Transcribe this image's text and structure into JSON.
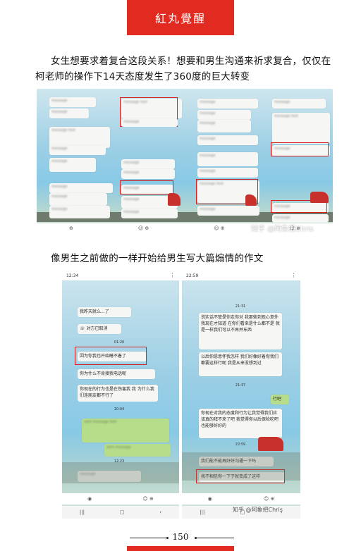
{
  "banner": {
    "title": "紅丸覺醒"
  },
  "paragraphs": {
    "p1": "女生想要求着复合这段关系！想要和男生沟通来祈求复合，仅仅在柯老师的操作下14天态度发生了360度的巨大转变",
    "p2": "像男生之前做的一样开始给男生写大篇煽情的作文"
  },
  "watermarks": {
    "top": "知乎 @阿象把Chris",
    "bottom": "知乎 @阿象把Chris"
  },
  "chat_left": {
    "status_time": "12:34",
    "messages": {
      "m1": "我昨天就么...了",
      "m2": "对方已取消",
      "t1": "01:20",
      "m3": "因为你我也开始睡不着了",
      "m4": "你为什么不肯接我电话呢",
      "m5": "你现在的行为也是在伤害我 我 为什么我们连朋友都不行了",
      "t2": "10:04",
      "t3": "12:23"
    }
  },
  "chat_right": {
    "status_time": "22:59",
    "messages": {
      "t1": "21:31",
      "m1": "说实话不管是你走你对 我那些到现心意外 我现在才知道 在你们看来是什么都不是 就是一样我们可以不再并东西",
      "m2": "以后你愿意怀我怎样 我们好像好着你我们都要这样行呢 我是从来没想到过",
      "t2": "21:37",
      "m3": "行吧",
      "m4": "你现在对我的态度和行为让我觉得我们应该真的拜不来了吧 我觉得你以后保险吃吧 也能够好好的",
      "t3": "22:59",
      "m5": "我们能不能再好好沟通一下吗",
      "m6": "我不相信你一下子就变成了这样"
    }
  },
  "footer": {
    "page_number": "150"
  },
  "colors": {
    "accent": "#e12a20",
    "highlight_box": "#d42020"
  }
}
